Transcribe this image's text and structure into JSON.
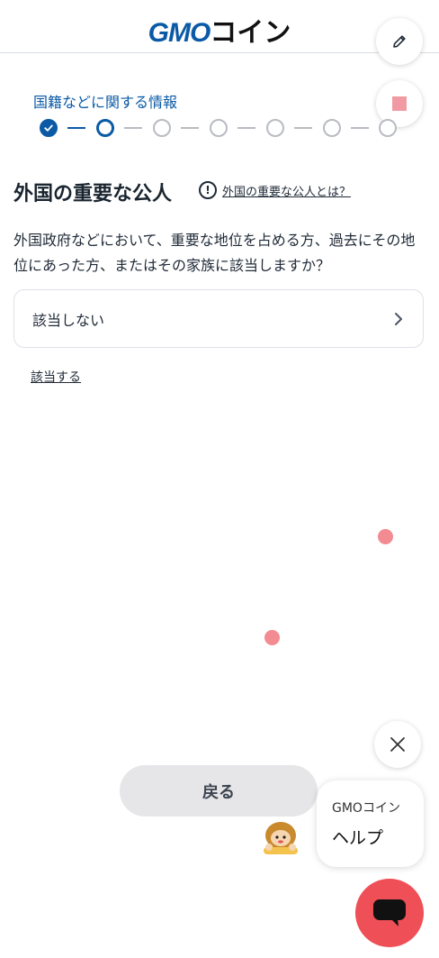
{
  "header": {
    "logo_gmo": "GMO",
    "logo_coin": "コイン"
  },
  "toolbar": {
    "edit_icon": "pencil-icon",
    "stop_icon": "stop-icon"
  },
  "progress": {
    "step_title": "国籍などに関する情報",
    "total_steps": 7,
    "current_step": 2
  },
  "main": {
    "title": "外国の重要な公人",
    "help_link": "外国の重要な公人とは？",
    "question": "外国政府などにおいて、重要な地位を占める方、過去にその地位にあった方、またはその家族に該当しますか？",
    "option_not_applicable": "該当しない",
    "option_applicable": "該当する"
  },
  "footer": {
    "back_label": "戻る"
  },
  "help_widget": {
    "brand": "GMOコイン",
    "label": "ヘルプ"
  },
  "colors": {
    "brand_blue": "#0b5aa6",
    "accent_red": "#ef4f57",
    "marker_pink": "#f28b92"
  }
}
